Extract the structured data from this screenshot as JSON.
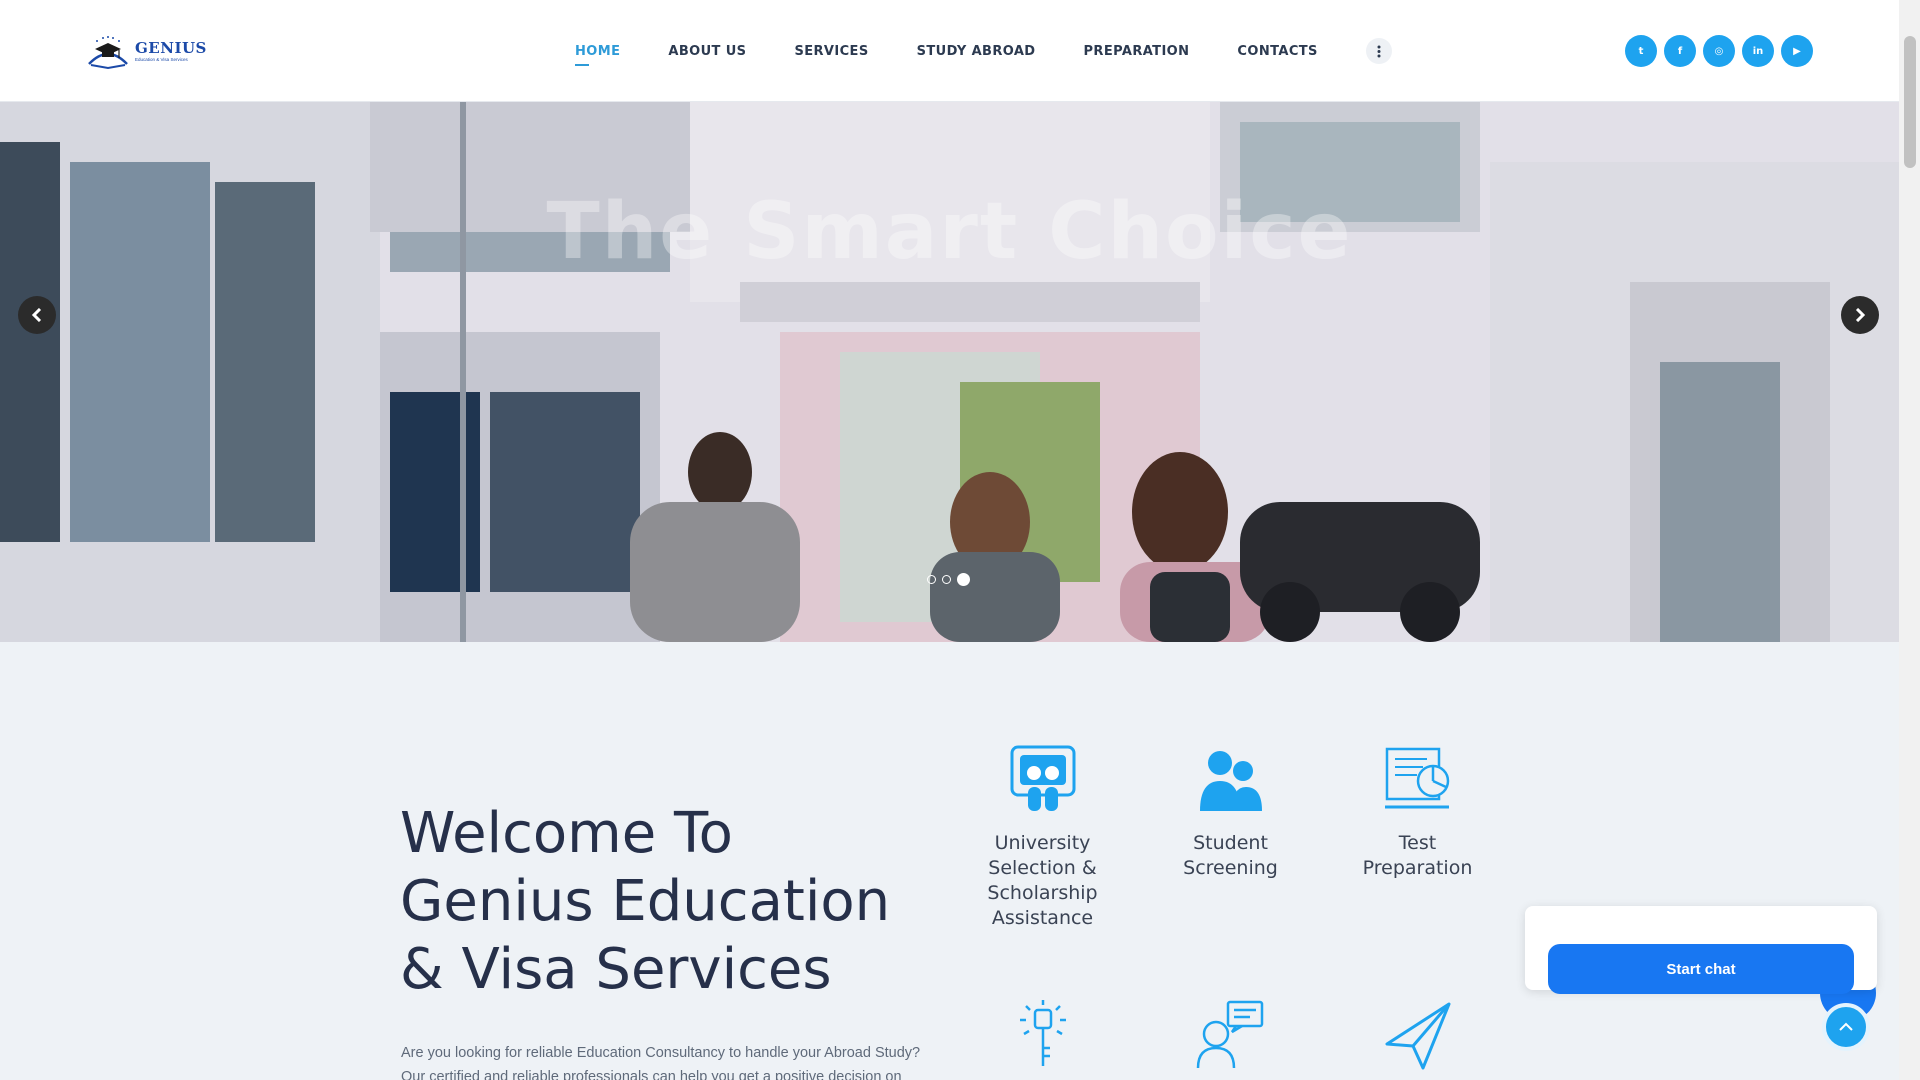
{
  "logo": {
    "name": "GENIUS",
    "subtitle": "Education & Visa Services"
  },
  "nav": {
    "items": [
      {
        "label": "HOME",
        "active": true
      },
      {
        "label": "ABOUT US",
        "active": false
      },
      {
        "label": "SERVICES",
        "active": false
      },
      {
        "label": "STUDY ABROAD",
        "active": false
      },
      {
        "label": "PREPARATION",
        "active": false
      },
      {
        "label": "CONTACTS",
        "active": false
      }
    ],
    "more_icon": "vertical-ellipsis-icon"
  },
  "socials": [
    {
      "name": "twitter-icon",
      "glyph": "t"
    },
    {
      "name": "facebook-icon",
      "glyph": "f"
    },
    {
      "name": "instagram-icon",
      "glyph": "◎"
    },
    {
      "name": "linkedin-icon",
      "glyph": "in"
    },
    {
      "name": "youtube-icon",
      "glyph": "▶"
    }
  ],
  "hero": {
    "title": "The Smart Choice",
    "slide_count": 3,
    "active_slide": 3
  },
  "welcome": {
    "title": "Welcome To Genius Education & Visa Services",
    "text": "Are you looking for reliable Education Consultancy to handle your Abroad Study? Our certified and reliable professionals can help you get a positive decision on"
  },
  "services": [
    {
      "label": "University Selection & Scholarship Assistance",
      "icon": "university-selection-icon"
    },
    {
      "label": "Student Screening",
      "icon": "student-screening-icon"
    },
    {
      "label": "Test Preparation",
      "icon": "test-preparation-icon"
    },
    {
      "label": "",
      "icon": "key-icon"
    },
    {
      "label": "",
      "icon": "consultation-icon"
    },
    {
      "label": "",
      "icon": "paper-plane-icon"
    }
  ],
  "chat": {
    "button_label": "Start chat"
  },
  "colors": {
    "accent": "#1ea3ef",
    "nav_active": "#2e9bd8",
    "chat_button": "#1877f2",
    "heading": "#26304a"
  }
}
